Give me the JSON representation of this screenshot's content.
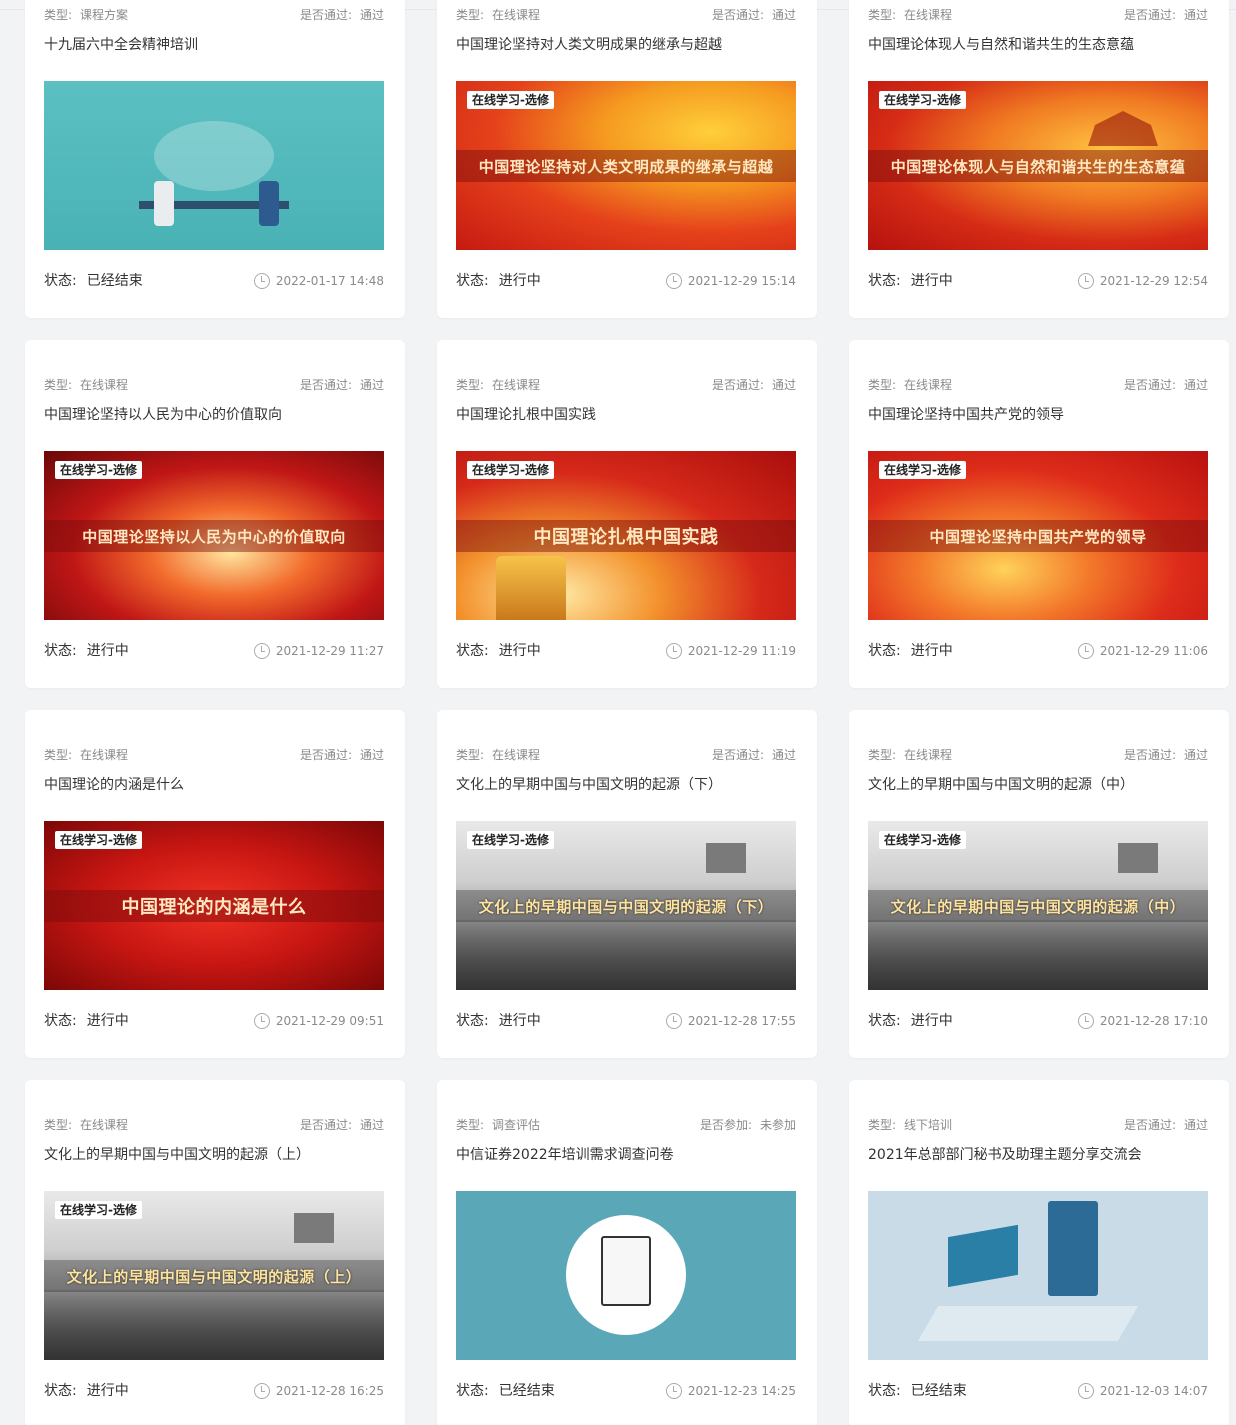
{
  "labels": {
    "type": "类型:",
    "passed": "是否通过:",
    "joined": "是否参加:",
    "status": "状态:"
  },
  "cards": [
    {
      "type": "课程方案",
      "check_label": "是否通过:",
      "check_value": "通过",
      "title": "十九届六中全会精神培训",
      "thumb_theme": "office",
      "tag": "",
      "banner": "",
      "status": "已经结束",
      "time": "2022-01-17 14:48"
    },
    {
      "type": "在线课程",
      "check_label": "是否通过:",
      "check_value": "通过",
      "title": "中国理论坚持对人类文明成果的继承与超越",
      "thumb_theme": "red1",
      "tag": "在线学习-选修",
      "banner": "中国理论坚持对人类文明成果的继承与超越",
      "status": "进行中",
      "time": "2021-12-29 15:14"
    },
    {
      "type": "在线课程",
      "check_label": "是否通过:",
      "check_value": "通过",
      "title": "中国理论体现人与自然和谐共生的生态意蕴",
      "thumb_theme": "red2",
      "tag": "在线学习-选修",
      "banner": "中国理论体现人与自然和谐共生的生态意蕴",
      "status": "进行中",
      "time": "2021-12-29 12:54"
    },
    {
      "type": "在线课程",
      "check_label": "是否通过:",
      "check_value": "通过",
      "title": "中国理论坚持以人民为中心的价值取向",
      "thumb_theme": "fire",
      "tag": "在线学习-选修",
      "banner": "中国理论坚持以人民为中心的价值取向",
      "status": "进行中",
      "time": "2021-12-29 11:27"
    },
    {
      "type": "在线课程",
      "check_label": "是否通过:",
      "check_value": "通过",
      "title": "中国理论扎根中国实践",
      "thumb_theme": "party",
      "tag": "在线学习-选修",
      "banner": "中国理论扎根中国实践",
      "status": "进行中",
      "time": "2021-12-29 11:19"
    },
    {
      "type": "在线课程",
      "check_label": "是否通过:",
      "check_value": "通过",
      "title": "中国理论坚持中国共产党的领导",
      "thumb_theme": "flag",
      "tag": "在线学习-选修",
      "banner": "中国理论坚持中国共产党的领导",
      "status": "进行中",
      "time": "2021-12-29 11:06"
    },
    {
      "type": "在线课程",
      "check_label": "是否通过:",
      "check_value": "通过",
      "title": "中国理论的内涵是什么",
      "thumb_theme": "deepred",
      "tag": "在线学习-选修",
      "banner": "中国理论的内涵是什么",
      "status": "进行中",
      "time": "2021-12-29 09:51"
    },
    {
      "type": "在线课程",
      "check_label": "是否通过:",
      "check_value": "通过",
      "title": "文化上的早期中国与中国文明的起源（下）",
      "thumb_theme": "ink",
      "tag": "在线学习-选修",
      "banner": "文化上的早期中国与中国文明的起源（下）",
      "status": "进行中",
      "time": "2021-12-28 17:55"
    },
    {
      "type": "在线课程",
      "check_label": "是否通过:",
      "check_value": "通过",
      "title": "文化上的早期中国与中国文明的起源（中）",
      "thumb_theme": "ink",
      "tag": "在线学习-选修",
      "banner": "文化上的早期中国与中国文明的起源（中）",
      "status": "进行中",
      "time": "2021-12-28 17:10"
    },
    {
      "type": "在线课程",
      "check_label": "是否通过:",
      "check_value": "通过",
      "title": "文化上的早期中国与中国文明的起源（上）",
      "thumb_theme": "ink",
      "tag": "在线学习-选修",
      "banner": "文化上的早期中国与中国文明的起源（上）",
      "status": "进行中",
      "time": "2021-12-28 16:25"
    },
    {
      "type": "调查评估",
      "check_label": "是否参加:",
      "check_value": "未参加",
      "title": "中信证券2022年培训需求调查问卷",
      "thumb_theme": "survey",
      "tag": "",
      "banner": "",
      "status": "已经结束",
      "time": "2021-12-23 14:25"
    },
    {
      "type": "线下培训",
      "check_label": "是否通过:",
      "check_value": "通过",
      "title": "2021年总部部门秘书及助理主题分享交流会",
      "thumb_theme": "meeting",
      "tag": "",
      "banner": "",
      "status": "已经结束",
      "time": "2021-12-03 14:07"
    }
  ]
}
